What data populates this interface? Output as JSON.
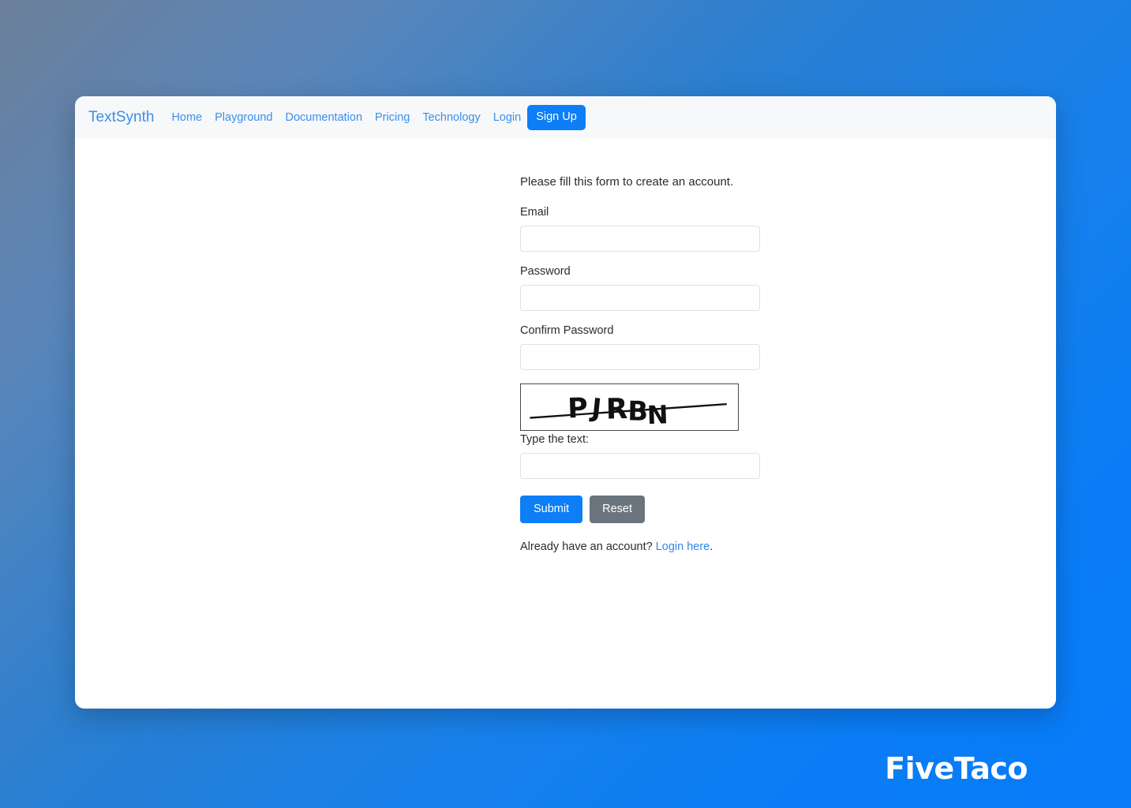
{
  "navbar": {
    "brand": "TextSynth",
    "links": [
      {
        "label": "Home"
      },
      {
        "label": "Playground"
      },
      {
        "label": "Documentation"
      },
      {
        "label": "Pricing"
      },
      {
        "label": "Technology"
      },
      {
        "label": "Login"
      }
    ],
    "signup_button": "Sign Up",
    "background_color": "#f6f8fa",
    "link_color": "#3b8fea",
    "accent_color": "#0d7ef5"
  },
  "form": {
    "intro": "Please fill this form to create an account.",
    "email": {
      "label": "Email",
      "value": "",
      "placeholder": ""
    },
    "password": {
      "label": "Password",
      "value": "",
      "placeholder": ""
    },
    "confirm_password": {
      "label": "Confirm Password",
      "value": "",
      "placeholder": ""
    },
    "captcha": {
      "image_text": "PJRBN",
      "characters": [
        "P",
        "J",
        "R",
        "B",
        "N"
      ],
      "label": "Type the text:",
      "value": "",
      "placeholder": ""
    },
    "submit_label": "Submit",
    "reset_label": "Reset",
    "footer_text": "Already have an account?",
    "footer_link": "Login here",
    "footer_period": ".",
    "submit_color": "#0d7ef5",
    "reset_color": "#6c757d",
    "link_color": "#2f8ae8"
  },
  "watermark": {
    "text": "FiveTaco"
  },
  "background": {
    "top_left": "#6b7f99",
    "top_right": "#2a7fd1",
    "bottom_left": "#077bf8",
    "bottom_right": "#0a7df6"
  }
}
